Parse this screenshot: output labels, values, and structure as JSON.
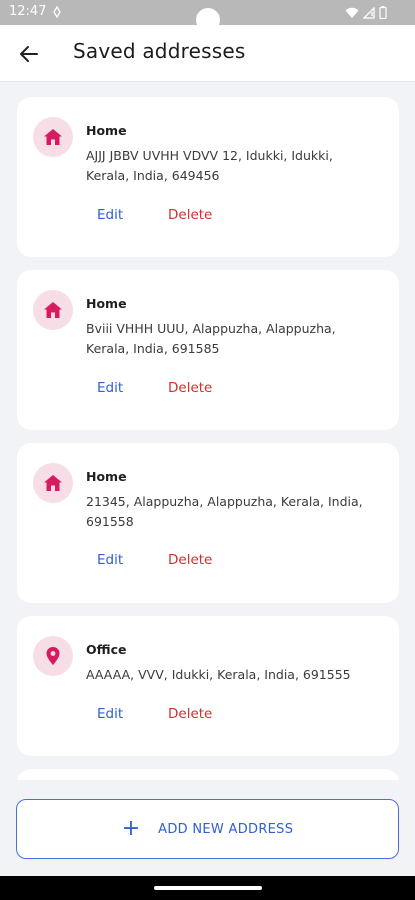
{
  "status_bar": {
    "time": "12:47"
  },
  "app_bar": {
    "title": "Saved addresses"
  },
  "addresses": [
    {
      "label": "Home",
      "icon": "home-icon",
      "address": "AJJJ JBBV UVHH VDVV 12, Idukki, Idukki, Kerala, India, 649456",
      "edit": "Edit",
      "delete": "Delete"
    },
    {
      "label": "Home",
      "icon": "home-icon",
      "address": "Bviii VHHH UUU, Alappuzha, Alappuzha, Kerala, India, 691585",
      "edit": "Edit",
      "delete": "Delete"
    },
    {
      "label": "Home",
      "icon": "home-icon",
      "address": "21345, Alappuzha, Alappuzha, Kerala, India, 691558",
      "edit": "Edit",
      "delete": "Delete"
    },
    {
      "label": "Office",
      "icon": "location-pin-icon",
      "address": "AAAAA, VVV, Idukki, Kerala, India, 691555",
      "edit": "Edit",
      "delete": "Delete"
    }
  ],
  "add_button": {
    "icon": "plus-icon",
    "label": "ADD NEW ADDRESS"
  },
  "colors": {
    "accent": "#2f5fd0",
    "danger": "#d32f2f",
    "icon_tint": "#d81b60",
    "icon_bg": "#f7dde5"
  }
}
